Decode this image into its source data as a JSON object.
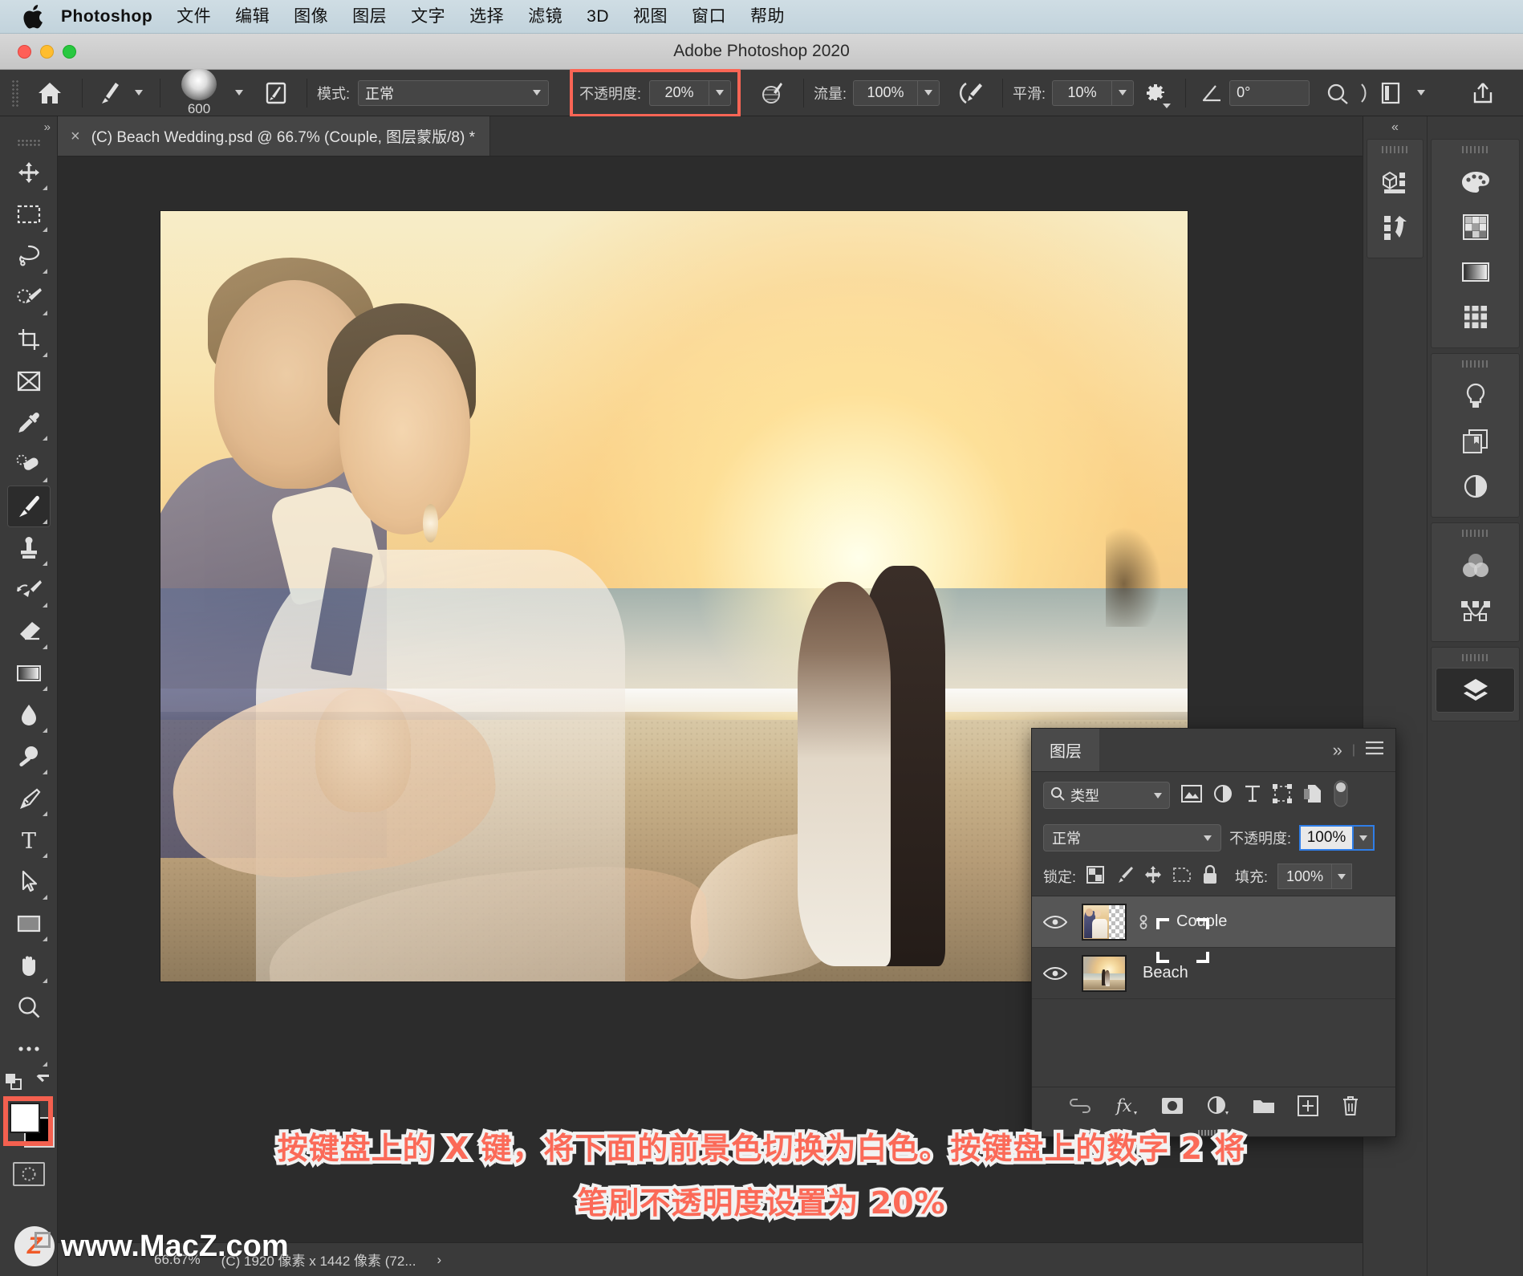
{
  "macmenu": {
    "apple_icon": "apple-logo-icon",
    "app_name": "Photoshop",
    "items": [
      "文件",
      "编辑",
      "图像",
      "图层",
      "文字",
      "选择",
      "滤镜",
      "3D",
      "视图",
      "窗口",
      "帮助"
    ]
  },
  "window": {
    "title": "Adobe Photoshop 2020"
  },
  "options_bar": {
    "home_icon": "home-icon",
    "brush_preset_icon": "brush-preset-icon",
    "brush_size": "600",
    "brush_panel_icon": "brush-panel-icon",
    "mode_label": "模式:",
    "mode_value": "正常",
    "opacity_label": "不透明度:",
    "opacity_value": "20%",
    "pressure_opacity_icon": "pressure-opacity-icon",
    "flow_label": "流量:",
    "flow_value": "100%",
    "airbrush_icon": "airbrush-icon",
    "smoothing_label": "平滑:",
    "smoothing_value": "10%",
    "smoothing_gear_icon": "gear-icon",
    "angle_icon": "angle-icon",
    "angle_value": "0°",
    "symmetry_icon": "symmetry-icon",
    "tablet_pressure_icon": "tablet-pressure-icon",
    "share_icon": "share-icon",
    "highlight_color": "#fb6555"
  },
  "document": {
    "close_icon": "close-icon",
    "tab_title": "(C) Beach Wedding.psd @ 66.7% (Couple, 图层蒙版/8) *"
  },
  "status_bar": {
    "zoom": "66.67%",
    "doc_size": "(C) 1920 像素 x 1442 像素 (72...",
    "expand_icon": "chevron-right-icon"
  },
  "tools": [
    {
      "name": "move-tool",
      "icon": "move-icon",
      "selected": false
    },
    {
      "name": "marquee-tool",
      "icon": "rectangular-marquee-icon",
      "selected": false
    },
    {
      "name": "lasso-tool",
      "icon": "lasso-icon",
      "selected": false
    },
    {
      "name": "quick-selection-tool",
      "icon": "quick-selection-icon",
      "selected": false
    },
    {
      "name": "crop-tool",
      "icon": "crop-icon",
      "selected": false
    },
    {
      "name": "frame-tool",
      "icon": "frame-icon",
      "selected": false
    },
    {
      "name": "eyedropper-tool",
      "icon": "eyedropper-icon",
      "selected": false
    },
    {
      "name": "healing-brush-tool",
      "icon": "healing-brush-icon",
      "selected": false
    },
    {
      "name": "brush-tool",
      "icon": "brush-icon",
      "selected": true
    },
    {
      "name": "clone-stamp-tool",
      "icon": "clone-stamp-icon",
      "selected": false
    },
    {
      "name": "history-brush-tool",
      "icon": "history-brush-icon",
      "selected": false
    },
    {
      "name": "eraser-tool",
      "icon": "eraser-icon",
      "selected": false
    },
    {
      "name": "gradient-tool",
      "icon": "gradient-icon",
      "selected": false
    },
    {
      "name": "blur-tool",
      "icon": "blur-drop-icon",
      "selected": false
    },
    {
      "name": "dodge-tool",
      "icon": "dodge-icon",
      "selected": false
    },
    {
      "name": "pen-tool",
      "icon": "pen-icon",
      "selected": false
    },
    {
      "name": "type-tool",
      "icon": "type-t-icon",
      "selected": false
    },
    {
      "name": "path-selection-tool",
      "icon": "path-selection-arrow-icon",
      "selected": false
    },
    {
      "name": "shape-tool",
      "icon": "rectangle-shape-icon",
      "selected": false
    },
    {
      "name": "hand-tool",
      "icon": "hand-icon",
      "selected": false
    },
    {
      "name": "zoom-tool",
      "icon": "magnifier-icon",
      "selected": false
    },
    {
      "name": "edit-toolbar",
      "icon": "ellipsis-icon",
      "selected": false
    }
  ],
  "toolbar_bottom": {
    "default_colors_icon": "default-colors-icon",
    "swap_colors_icon": "swap-colors-icon",
    "foreground_color": "#ffffff",
    "background_color": "#000000",
    "quick_mask_icon": "quick-mask-icon",
    "highlight_color": "#f4604f"
  },
  "right_panel": {
    "collapse_icon": "collapse-chevrons-icon",
    "groups": [
      {
        "icons": [
          "3d-panel-icon",
          "3d-undo-icon"
        ]
      },
      {
        "icons": [
          "color-palette-icon",
          "swatches-grid-icon",
          "gradients-icon",
          "patterns-icon"
        ]
      },
      {
        "icons": [
          "learn-bulb-icon",
          "libraries-icon",
          "adjustments-icon"
        ]
      },
      {
        "icons": [
          "channels-icon",
          "paths-icon"
        ]
      },
      {
        "icons": [
          "layers-stack-icon"
        ]
      }
    ]
  },
  "layers_panel": {
    "tab_label": "图层",
    "expand_icon": "double-chevron-right-icon",
    "menu_icon": "hamburger-menu-icon",
    "filter": {
      "search_icon": "search-icon",
      "type_label": "类型",
      "dropdown_icon": "chevron-down-icon",
      "filter_icons": [
        "image-filter-icon",
        "adjustment-filter-icon",
        "type-filter-icon",
        "shape-filter-icon",
        "smartobject-filter-icon"
      ],
      "toggle_icon": "filter-toggle-icon"
    },
    "blend_mode": "正常",
    "opacity_label": "不透明度:",
    "opacity_value": "100%",
    "lock_label": "锁定:",
    "lock_icons": [
      "lock-transparency-icon",
      "lock-image-icon",
      "lock-position-icon",
      "lock-artboard-icon",
      "lock-all-icon"
    ],
    "fill_label": "填充:",
    "fill_value": "100%",
    "layers": [
      {
        "name": "Couple",
        "visible": true,
        "selected": true,
        "has_mask": true,
        "linked": true,
        "eye_icon": "eye-icon"
      },
      {
        "name": "Beach",
        "visible": true,
        "selected": false,
        "has_mask": false,
        "linked": false,
        "eye_icon": "eye-icon"
      }
    ],
    "bottom_icons": [
      "link-layers-icon",
      "layer-style-fx-icon",
      "add-mask-icon",
      "adjustment-layer-icon",
      "new-group-icon",
      "new-layer-icon",
      "delete-layer-icon"
    ]
  },
  "annotation": {
    "line1": "按键盘上的 X 键，将下面的前景色切换为白色。按键盘上的数字 2 将",
    "line2": "笔刷不透明度设置为 20%",
    "text_color": "#fb6a58",
    "outline_color": "#f2f2f2"
  },
  "watermark": {
    "letter": "Z",
    "text": "www.MacZ.com"
  }
}
